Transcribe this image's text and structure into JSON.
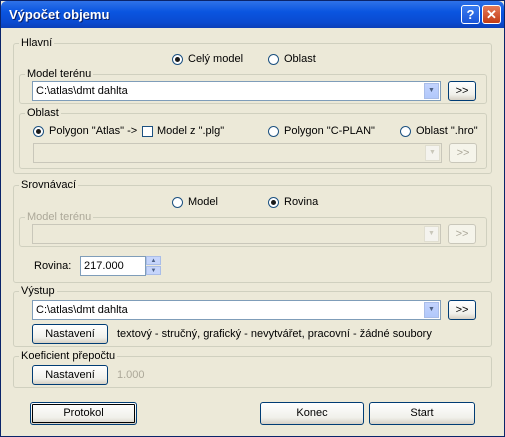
{
  "window": {
    "title": "Výpočet objemu",
    "help_glyph": "?",
    "close_glyph": "✕"
  },
  "hlavni": {
    "legend": "Hlavní",
    "radio_cely": "Celý model",
    "radio_oblast": "Oblast",
    "selected": "Celý model",
    "model_terenu": {
      "legend": "Model terénu",
      "value": "C:\\atlas\\dmt dahlta",
      "browse": ">>"
    },
    "oblast": {
      "legend": "Oblast",
      "radio_atlas": "Polygon \"Atlas\" ->",
      "check_plg": "Model z \".plg\"",
      "check_plg_checked": false,
      "radio_cplan": "Polygon \"C-PLAN\"",
      "radio_hro": "Oblast \".hro\"",
      "selected": "Polygon \"Atlas\" ->",
      "value": "",
      "browse": ">>"
    }
  },
  "srovnavaci": {
    "legend": "Srovnávací",
    "radio_model": "Model",
    "radio_rovina": "Rovina",
    "selected": "Rovina",
    "model_terenu": {
      "legend": "Model terénu",
      "value": "",
      "browse": ">>"
    },
    "rovina_label": "Rovina:",
    "rovina_value": "217.000"
  },
  "vystup": {
    "legend": "Výstup",
    "value": "C:\\atlas\\dmt dahlta",
    "browse": ">>",
    "settings_button": "Nastavení",
    "settings_summary": "textový - stručný,  grafický - nevytvářet,  pracovní - žádné soubory"
  },
  "koeficient": {
    "legend": "Koeficient přepočtu",
    "settings_button": "Nastavení",
    "value": "1.000"
  },
  "footer": {
    "protokol": "Protokol",
    "konec": "Konec",
    "start": "Start"
  },
  "icons": {
    "dropdown": "▼",
    "spin_up": "▲",
    "spin_down": "▼"
  }
}
